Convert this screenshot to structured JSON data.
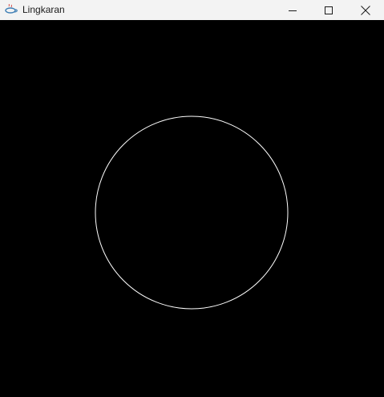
{
  "window": {
    "title": "Lingkaran",
    "app_icon": "java-cup-icon",
    "controls": {
      "minimize_icon": "minimize-icon",
      "maximize_icon": "maximize-icon",
      "close_icon": "close-icon"
    }
  },
  "canvas": {
    "background_color": "#000000",
    "shape": "circle",
    "stroke_color": "#ffffff"
  }
}
